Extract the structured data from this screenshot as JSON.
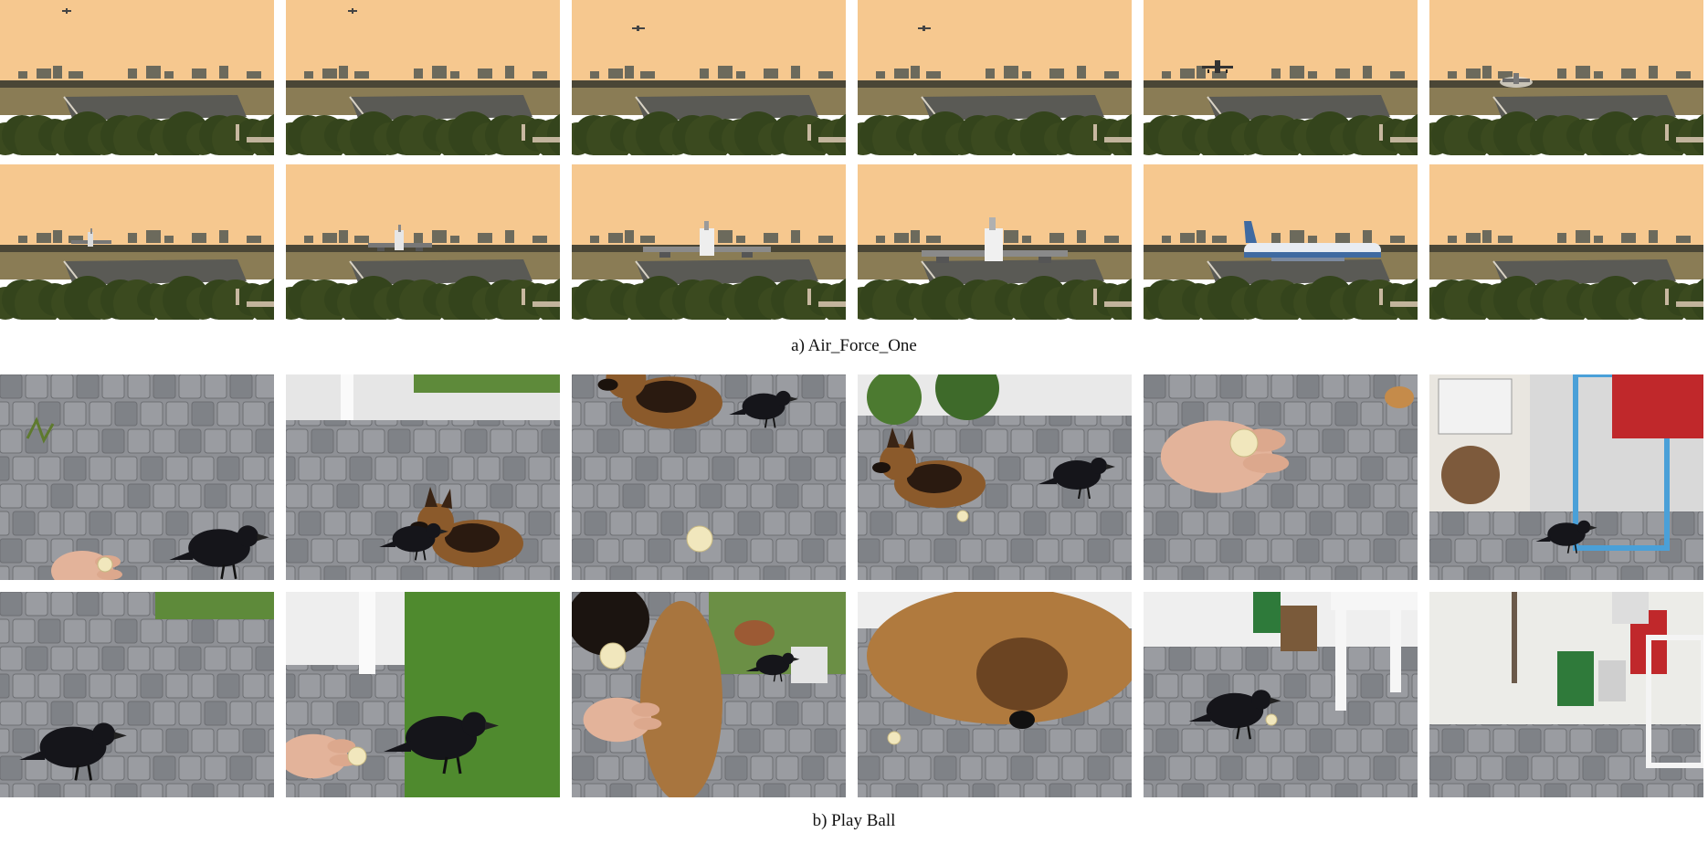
{
  "figure": {
    "caption_a": "a) Air_Force_One",
    "caption_b": "b) Play Ball"
  },
  "colors": {
    "sky": "#f6c88f",
    "horizon": "#4a4636",
    "runway": "#5a5a55",
    "field": "#8a7c55",
    "trees": "#3b4a1f",
    "pavement": "#8e9095",
    "crow": "#15151a",
    "dog": "#8b5a2b"
  },
  "air_force_one_frames": [
    {
      "plane": "tiny-high"
    },
    {
      "plane": "tiny-high"
    },
    {
      "plane": "tiny"
    },
    {
      "plane": "tiny"
    },
    {
      "plane": "approach"
    },
    {
      "plane": "touchdown"
    },
    {
      "plane": "rollout-far"
    },
    {
      "plane": "rollout"
    },
    {
      "plane": "rollout-near"
    },
    {
      "plane": "rollout-nearer"
    },
    {
      "plane": "taxi-side"
    },
    {
      "plane": "none"
    }
  ],
  "play_ball_frames": [
    {
      "scene": "crow-hand-ball"
    },
    {
      "scene": "crow-dog-yard"
    },
    {
      "scene": "dog-crow-ball"
    },
    {
      "scene": "dog-crow-facing"
    },
    {
      "scene": "hand-holding-ball"
    },
    {
      "scene": "crow-crate-rack"
    },
    {
      "scene": "crow-pavement"
    },
    {
      "scene": "hand-crow-grass"
    },
    {
      "scene": "dog-hand-crow"
    },
    {
      "scene": "dog-closeup"
    },
    {
      "scene": "crow-chair-ball"
    },
    {
      "scene": "empty-yard"
    }
  ]
}
